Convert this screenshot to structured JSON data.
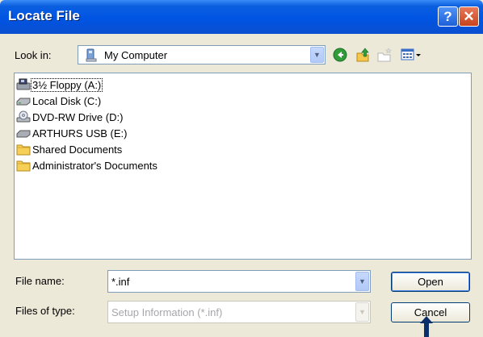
{
  "dialog": {
    "title": "Locate File"
  },
  "title_buttons": {
    "help": "?",
    "close": "✕"
  },
  "toolbar": {
    "look_in_label": "Look in:",
    "look_in_value": "My Computer",
    "icons": [
      "back-icon",
      "up-folder-icon",
      "new-folder-icon",
      "view-menu-icon"
    ]
  },
  "file_list": [
    {
      "label": "3½ Floppy (A:)",
      "icon": "floppy-drive-icon",
      "selected": true
    },
    {
      "label": "Local Disk (C:)",
      "icon": "hard-disk-icon",
      "selected": false
    },
    {
      "label": "DVD-RW Drive (D:)",
      "icon": "dvd-drive-icon",
      "selected": false
    },
    {
      "label": "ARTHURS USB (E:)",
      "icon": "usb-drive-icon",
      "selected": false
    },
    {
      "label": "Shared Documents",
      "icon": "folder-icon",
      "selected": false
    },
    {
      "label": "Administrator's Documents",
      "icon": "folder-icon",
      "selected": false
    }
  ],
  "file_name": {
    "label": "File name:",
    "value": "*.inf"
  },
  "file_type": {
    "label": "Files of type:",
    "value": "Setup Information (*.inf)"
  },
  "buttons": {
    "open": "Open",
    "cancel": "Cancel"
  },
  "colors": {
    "titlebar": "#0054e3",
    "accent": "#316ac5",
    "window_bg": "#ece9d8"
  }
}
